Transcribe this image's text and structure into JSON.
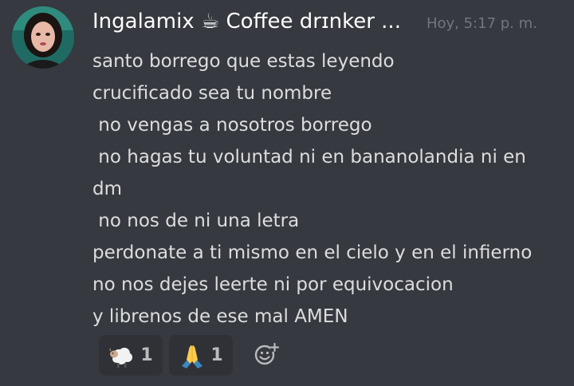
{
  "message": {
    "username": "Ingalamix ☕ Coffee drɪnker ...",
    "timestamp": "Hoy, 5:17 p. m.",
    "lines": [
      "santo borrego que estas leyendo",
      "crucificado sea tu nombre",
      " no vengas a nosotros borrego",
      " no hagas tu voluntad ni en bananolandia ni en",
      "dm",
      " no nos de ni una letra",
      "perdonate a ti mismo en el cielo y en el infierno",
      "no nos dejes leerte ni por equivocacion",
      "y librenos de ese mal AMEN"
    ]
  },
  "reactions": [
    {
      "icon": "sheep-icon",
      "count": "1"
    },
    {
      "icon": "praying-hands-icon",
      "count": "1"
    }
  ],
  "add_reaction_icon": "add-reaction-icon",
  "colors": {
    "background": "#36393f",
    "username": "#ffffff",
    "timestamp": "#72767d",
    "text": "#dcddde",
    "reaction_bg": "#2f3136",
    "reaction_count": "#b9bbbe"
  }
}
